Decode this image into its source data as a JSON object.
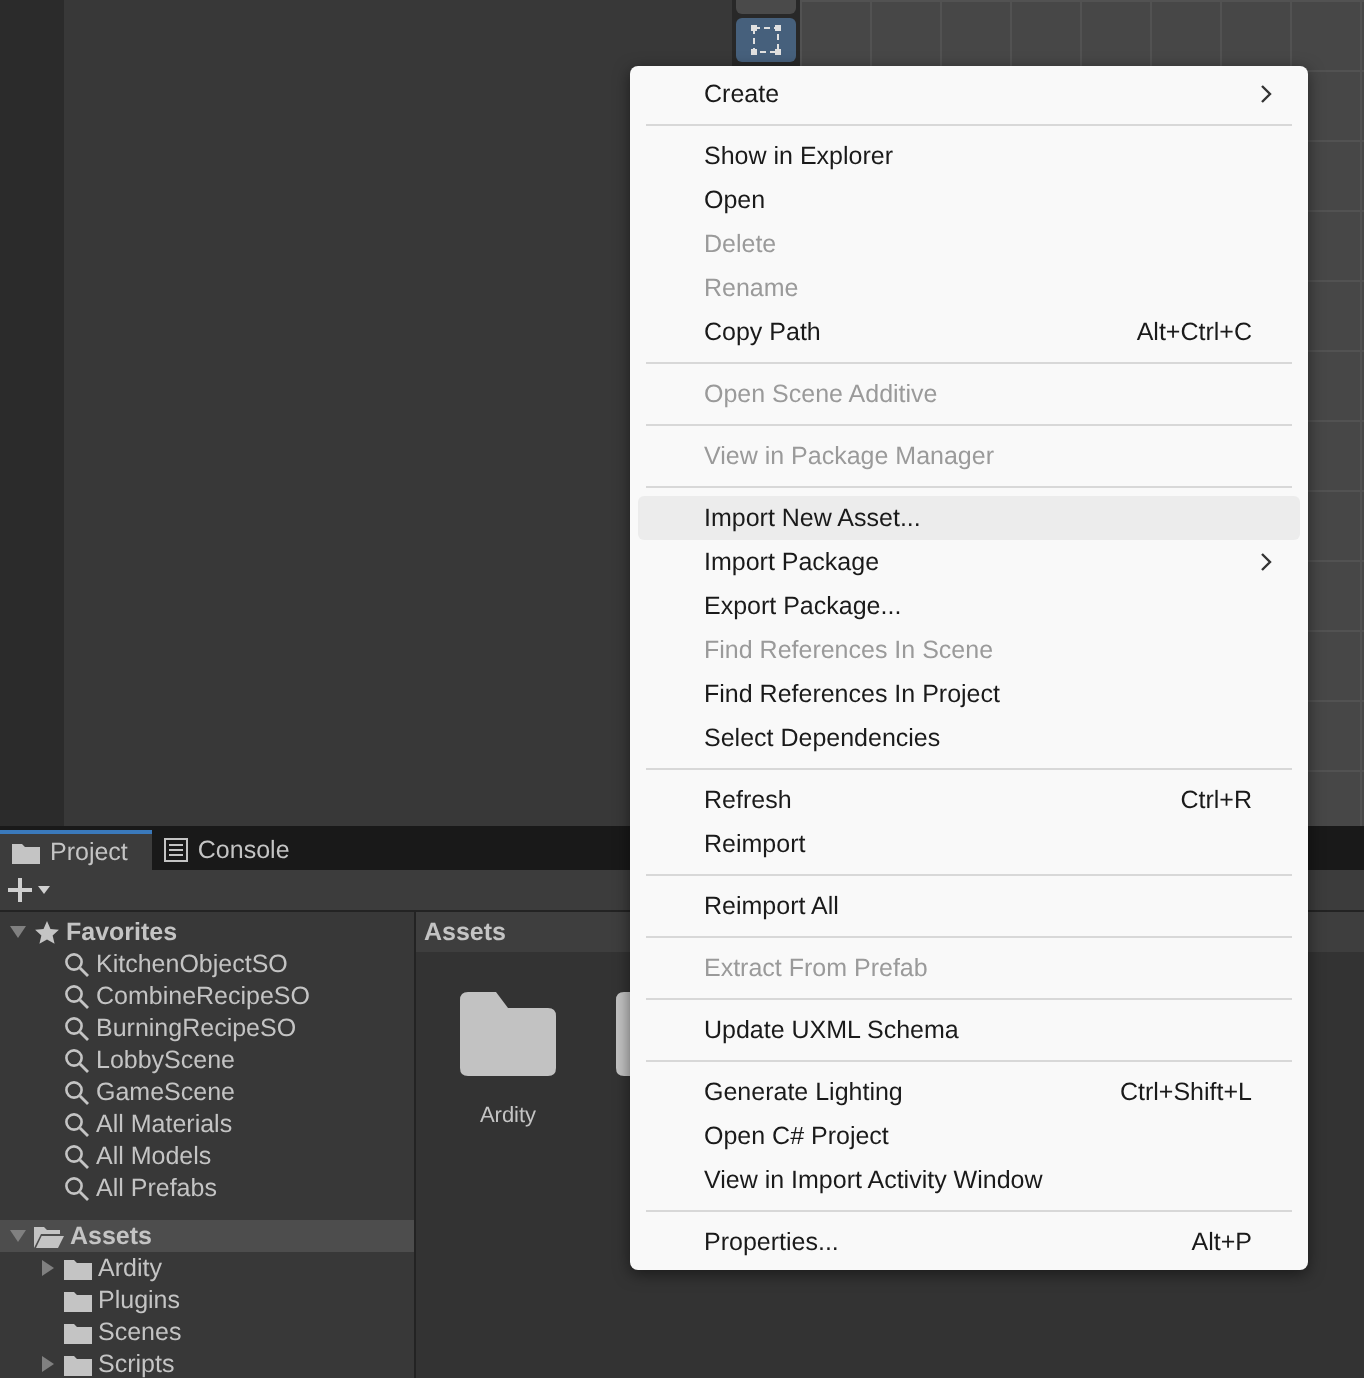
{
  "tabs": [
    {
      "label": "Project",
      "selected": true
    },
    {
      "label": "Console",
      "selected": false
    }
  ],
  "tree": [
    {
      "label": "Favorites",
      "kind": "star",
      "expanded": true,
      "selected": false,
      "children": [
        {
          "label": "KitchenObjectSO",
          "kind": "search"
        },
        {
          "label": "CombineRecipeSO",
          "kind": "search"
        },
        {
          "label": "BurningRecipeSO",
          "kind": "search"
        },
        {
          "label": "LobbyScene",
          "kind": "search"
        },
        {
          "label": "GameScene",
          "kind": "search"
        },
        {
          "label": "All Materials",
          "kind": "search"
        },
        {
          "label": "All Models",
          "kind": "search"
        },
        {
          "label": "All Prefabs",
          "kind": "search"
        }
      ]
    },
    {
      "label": "Assets",
      "kind": "root",
      "expanded": true,
      "selected": true,
      "children": [
        {
          "label": "Ardity",
          "kind": "folder",
          "expanded": false
        },
        {
          "label": "Plugins",
          "kind": "folder"
        },
        {
          "label": "Scenes",
          "kind": "folder"
        },
        {
          "label": "Scripts",
          "kind": "folder",
          "expanded": false
        }
      ]
    }
  ],
  "breadcrumb": "Assets",
  "assets": [
    {
      "label": "Ardity"
    }
  ],
  "menu": [
    [
      {
        "label": "Create",
        "disabled": false,
        "selected": false,
        "submenu": true
      }
    ],
    [
      {
        "label": "Show in Explorer",
        "disabled": false,
        "selected": false,
        "submenu": false
      },
      {
        "label": "Open",
        "disabled": false,
        "selected": false,
        "submenu": false
      },
      {
        "label": "Delete",
        "disabled": true,
        "selected": false,
        "submenu": false
      },
      {
        "label": "Rename",
        "disabled": true,
        "selected": false,
        "submenu": false
      },
      {
        "label": "Copy Path",
        "shortcut": "Alt+Ctrl+C",
        "disabled": false,
        "selected": false,
        "submenu": false
      }
    ],
    [
      {
        "label": "Open Scene Additive",
        "disabled": true,
        "selected": false,
        "submenu": false
      }
    ],
    [
      {
        "label": "View in Package Manager",
        "disabled": true,
        "selected": false,
        "submenu": false
      }
    ],
    [
      {
        "label": "Import New Asset...",
        "disabled": false,
        "selected": true,
        "submenu": false
      },
      {
        "label": "Import Package",
        "disabled": false,
        "selected": false,
        "submenu": true
      },
      {
        "label": "Export Package...",
        "disabled": false,
        "selected": false,
        "submenu": false
      },
      {
        "label": "Find References In Scene",
        "disabled": true,
        "selected": false,
        "submenu": false
      },
      {
        "label": "Find References In Project",
        "disabled": false,
        "selected": false,
        "submenu": false
      },
      {
        "label": "Select Dependencies",
        "disabled": false,
        "selected": false,
        "submenu": false
      }
    ],
    [
      {
        "label": "Refresh",
        "shortcut": "Ctrl+R",
        "disabled": false,
        "selected": false,
        "submenu": false
      },
      {
        "label": "Reimport",
        "disabled": false,
        "selected": false,
        "submenu": false
      }
    ],
    [
      {
        "label": "Reimport All",
        "disabled": false,
        "selected": false,
        "submenu": false
      }
    ],
    [
      {
        "label": "Extract From Prefab",
        "disabled": true,
        "selected": false,
        "submenu": false
      }
    ],
    [
      {
        "label": "Update UXML Schema",
        "disabled": false,
        "selected": false,
        "submenu": false
      }
    ],
    [
      {
        "label": "Generate Lighting",
        "shortcut": "Ctrl+Shift+L",
        "disabled": false,
        "selected": false,
        "submenu": false
      },
      {
        "label": "Open C# Project",
        "disabled": false,
        "selected": false,
        "submenu": false
      },
      {
        "label": "View in Import Activity Window",
        "disabled": false,
        "selected": false,
        "submenu": false
      }
    ],
    [
      {
        "label": "Properties...",
        "shortcut": "Alt+P",
        "disabled": false,
        "selected": false,
        "submenu": false
      }
    ]
  ]
}
